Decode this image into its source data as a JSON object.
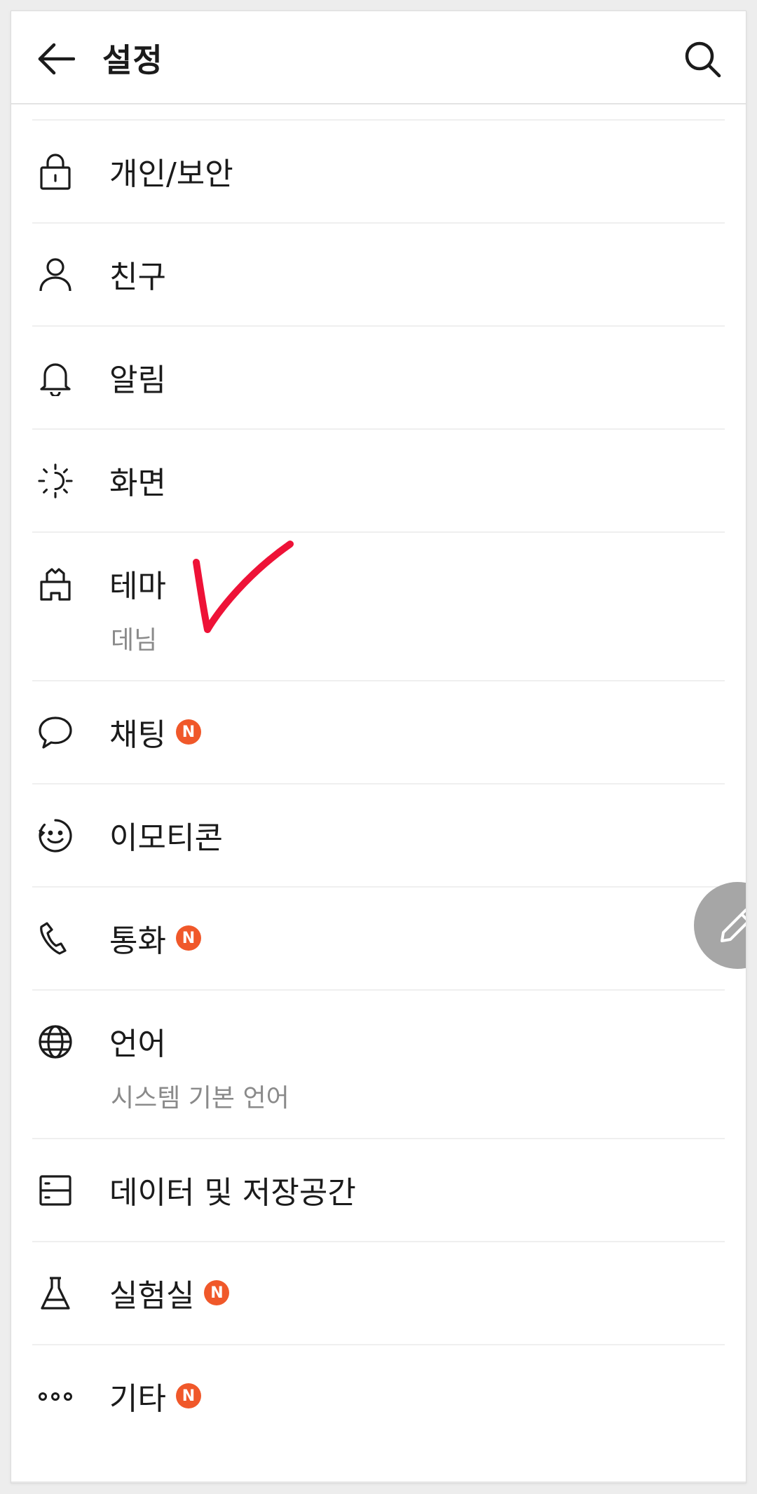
{
  "header": {
    "title": "설정",
    "back_icon": "arrow-left-icon",
    "search_icon": "search-icon"
  },
  "items": [
    {
      "label": "개인/보안",
      "icon": "lock-icon",
      "sub": null,
      "badge": null
    },
    {
      "label": "친구",
      "icon": "person-icon",
      "sub": null,
      "badge": null
    },
    {
      "label": "알림",
      "icon": "bell-icon",
      "sub": null,
      "badge": null
    },
    {
      "label": "화면",
      "icon": "sun-icon",
      "sub": null,
      "badge": null
    },
    {
      "label": "테마",
      "icon": "paint-brush-icon",
      "sub": "데님",
      "badge": null
    },
    {
      "label": "채팅",
      "icon": "chat-bubble-icon",
      "sub": null,
      "badge": "N"
    },
    {
      "label": "이모티콘",
      "icon": "smiley-icon",
      "sub": null,
      "badge": null
    },
    {
      "label": "통화",
      "icon": "phone-icon",
      "sub": null,
      "badge": "N"
    },
    {
      "label": "언어",
      "icon": "globe-icon",
      "sub": "시스템 기본 언어",
      "badge": null
    },
    {
      "label": "데이터 및 저장공간",
      "icon": "storage-icon",
      "sub": null,
      "badge": null
    },
    {
      "label": "실험실",
      "icon": "flask-icon",
      "sub": null,
      "badge": "N"
    },
    {
      "label": "기타",
      "icon": "more-dots-icon",
      "sub": null,
      "badge": "N"
    }
  ],
  "fab": {
    "icon": "pencil-icon"
  },
  "colors": {
    "badge": "#f0582a",
    "annotation": "#ee1237",
    "fab": "#a6a6a6",
    "text": "#1b1b1b",
    "subtext": "#8a8a8a"
  }
}
